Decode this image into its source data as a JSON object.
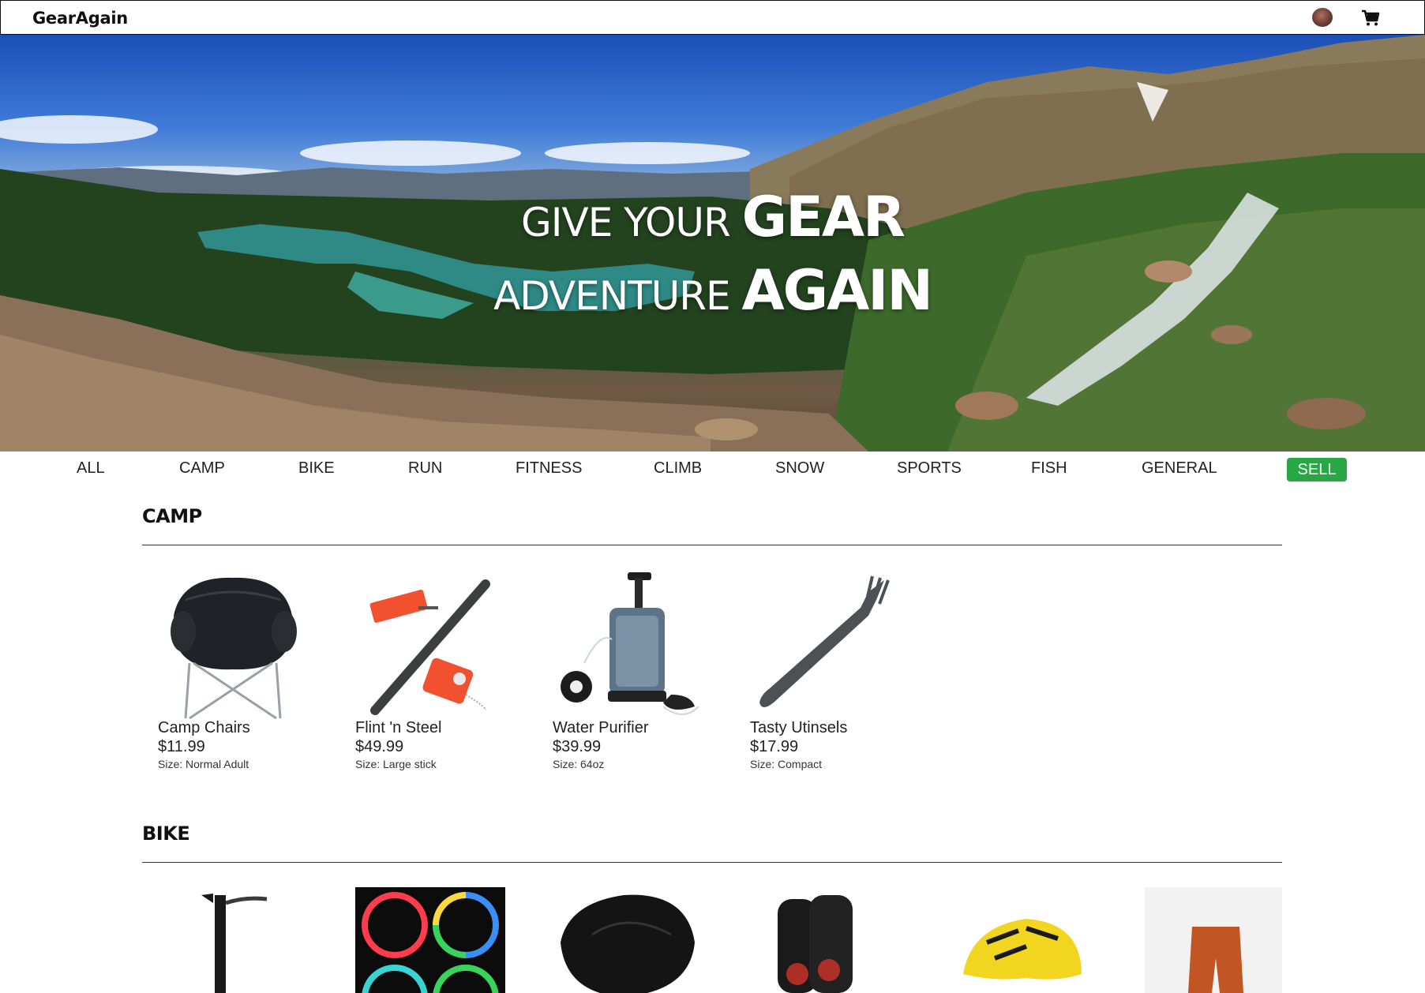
{
  "header": {
    "brand": "GearAgain",
    "avatar_icon": "user-avatar",
    "cart_icon": "cart-icon"
  },
  "hero": {
    "line1_light": "GIVE YOUR ",
    "line1_bold": "GEAR",
    "line2_light": "ADVENTURE ",
    "line2_bold": "AGAIN"
  },
  "categories": [
    "ALL",
    "CAMP",
    "BIKE",
    "RUN",
    "FITNESS",
    "CLIMB",
    "SNOW",
    "SPORTS",
    "FISH",
    "GENERAL"
  ],
  "sell_label": "SELL",
  "colors": {
    "sell_button": "#28a745",
    "text": "#222222"
  },
  "sections": [
    {
      "title": "CAMP",
      "items": [
        {
          "name": "Camp Chairs",
          "price": "$11.99",
          "size": "Size: Normal Adult",
          "image": "camp-chair-image"
        },
        {
          "name": "Flint 'n Steel",
          "price": "$49.99",
          "size": "Size: Large stick",
          "image": "flint-steel-image"
        },
        {
          "name": "Water Purifier",
          "price": "$39.99",
          "size": "Size: 64oz",
          "image": "water-purifier-image"
        },
        {
          "name": "Tasty Utinsels",
          "price": "$17.99",
          "size": "Size: Compact",
          "image": "spork-image"
        }
      ]
    },
    {
      "title": "BIKE",
      "items": [
        {
          "image": "bike-pump-image"
        },
        {
          "image": "wheel-lights-image"
        },
        {
          "image": "bike-saddle-image"
        },
        {
          "image": "knee-pads-image"
        },
        {
          "image": "helmet-image"
        },
        {
          "image": "bike-shorts-image"
        }
      ]
    }
  ]
}
